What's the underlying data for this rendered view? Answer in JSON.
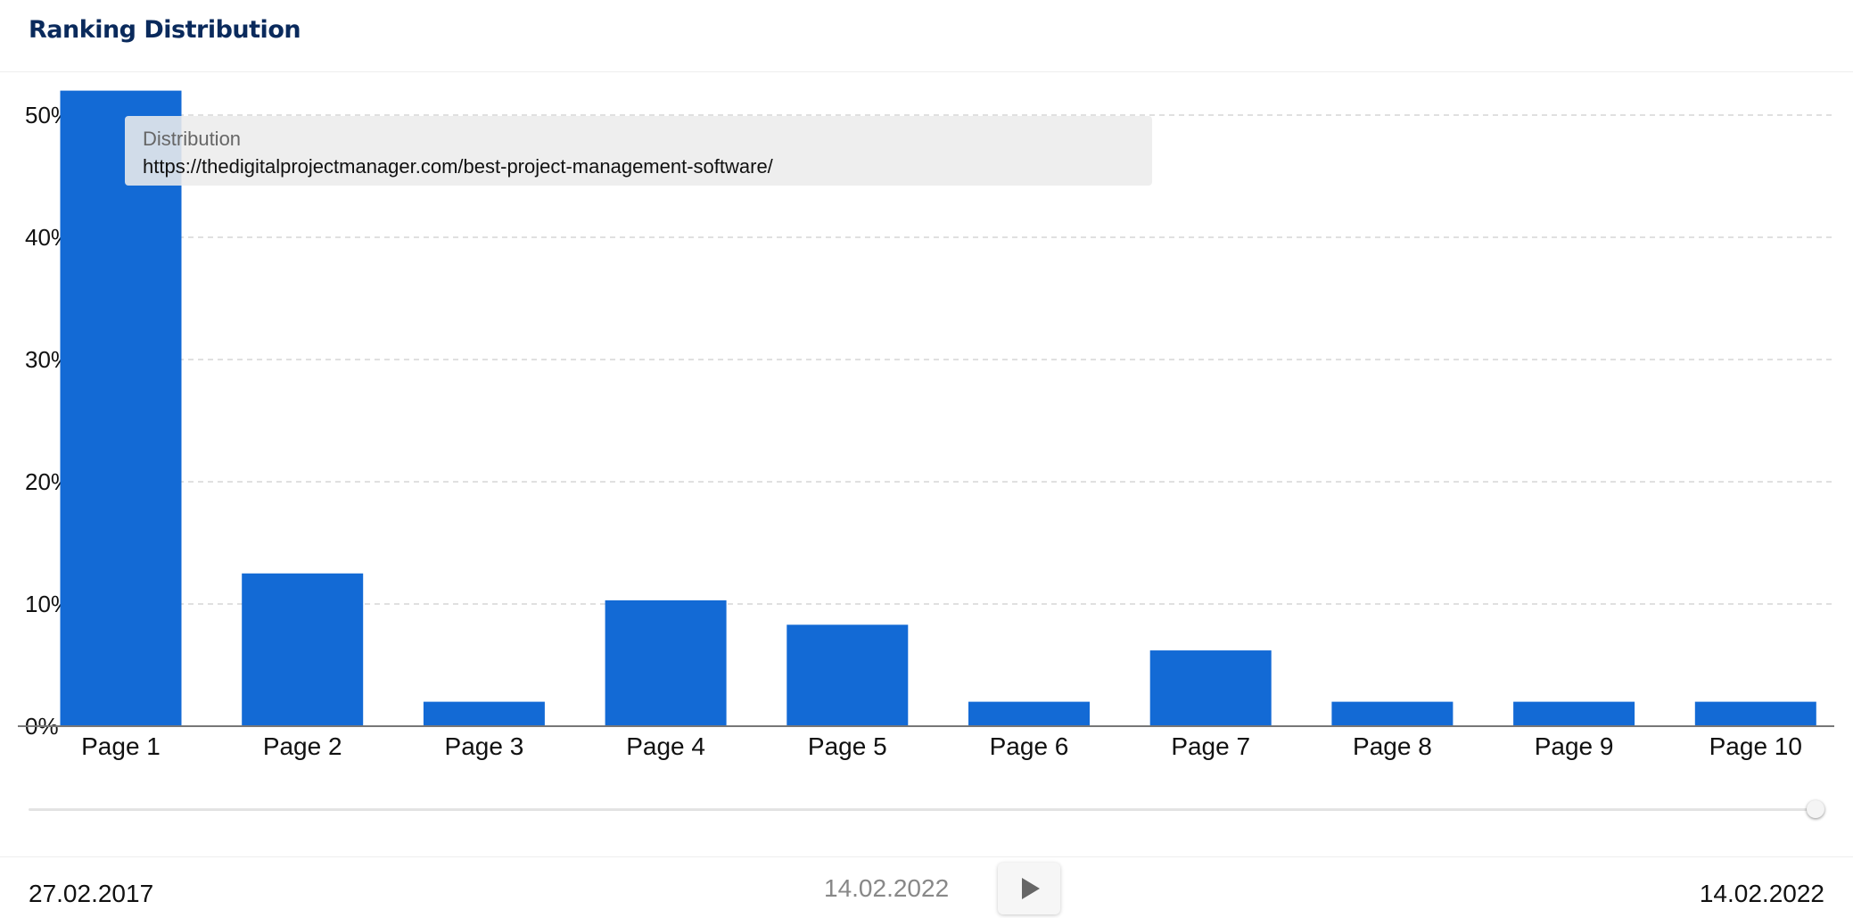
{
  "header": {
    "title": "Ranking Distribution"
  },
  "tooltip": {
    "title": "Distribution",
    "url": "https://thedigitalprojectmanager.com/best-project-management-software/"
  },
  "chart_data": {
    "type": "bar",
    "categories": [
      "Page 1",
      "Page 2",
      "Page 3",
      "Page 4",
      "Page 5",
      "Page 6",
      "Page 7",
      "Page 8",
      "Page 9",
      "Page 10"
    ],
    "values": [
      52,
      12.5,
      2,
      10.3,
      8.3,
      2,
      6.2,
      2,
      2,
      2
    ],
    "y_ticks": [
      "0%",
      "10%",
      "20%",
      "30%",
      "40%",
      "50%"
    ],
    "ylim": [
      0,
      52.5
    ],
    "grid": true,
    "color": "#136ad5"
  },
  "slider": {
    "position": 1.0
  },
  "footer": {
    "start_date": "27.02.2017",
    "current_date": "14.02.2022",
    "end_date": "14.02.2022",
    "play_icon": "play-icon"
  }
}
